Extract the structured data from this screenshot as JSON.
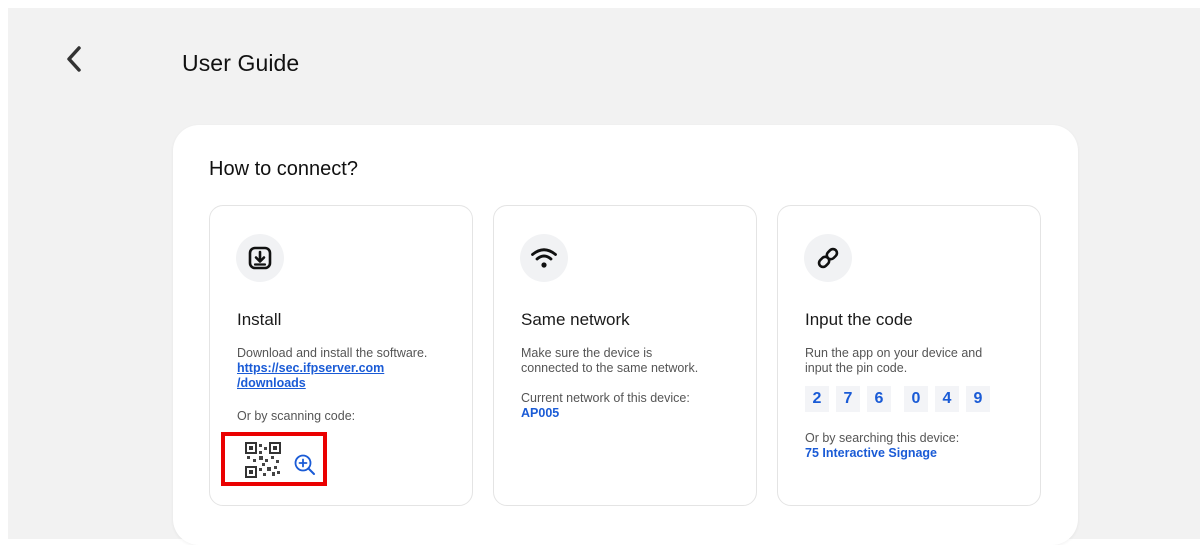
{
  "header": {
    "title": "User Guide",
    "back_icon": "chevron-left-icon"
  },
  "section": {
    "title": "How to connect?"
  },
  "steps": {
    "install": {
      "icon": "download-icon",
      "title": "Install",
      "description": "Download and install the software.",
      "link_line1": "https://sec.ifpserver.com",
      "link_line2": "/downloads",
      "scan_label": "Or by scanning code:",
      "qr_icon": "qr-code-icon",
      "zoom_icon": "zoom-in-icon"
    },
    "network": {
      "icon": "wifi-icon",
      "title": "Same network",
      "description_line1": "Make sure the device is",
      "description_line2": "connected to the same network.",
      "current_label": "Current network of this device:",
      "current_value": "AP005"
    },
    "code": {
      "icon": "link-icon",
      "title": "Input the code",
      "description_line1": "Run the app on your device and",
      "description_line2": "input the pin code.",
      "pin": [
        "2",
        "7",
        "6",
        "0",
        "4",
        "9"
      ],
      "search_label": "Or by searching this device:",
      "device_name": "75 Interactive Signage"
    }
  },
  "colors": {
    "accent": "#1a5bd6",
    "highlight": "#ea0000",
    "background": "#f2f2f2"
  }
}
